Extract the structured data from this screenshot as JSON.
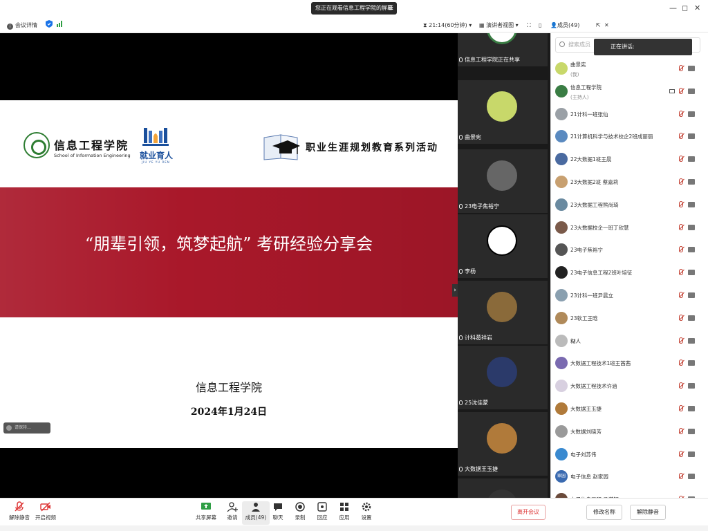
{
  "titlebar": {
    "share_banner": "您正在观看信息工程学院的屏幕",
    "window_controls": [
      "—",
      "◻",
      "✕"
    ]
  },
  "infobar": {
    "meeting_details": "会议详情",
    "timer": "21:14(60分钟)",
    "view_mode": "演讲者视图",
    "participants": "成员(49)"
  },
  "slide": {
    "school_cn": "信息工程学院",
    "school_en": "School of Information Engineering",
    "jy_cn": "就业育人",
    "jy_en": "JIU YE YU REN",
    "career_text": "职业生涯规划教育系列活动",
    "title": "“朋辈引领，筑梦起航” 考研经验分享会",
    "org": "信息工程学院",
    "date": "2024年1月24日",
    "toast": "请保持…"
  },
  "video_tiles": [
    {
      "label": "信息工程学院正在共享",
      "avatar_color": "#3a7d44"
    },
    {
      "label": "曲景宪",
      "avatar_color": "#c8d86a"
    },
    {
      "label": "23电子焦裕宁",
      "avatar_color": "#666666"
    },
    {
      "label": "李杨",
      "avatar_color": "#ffffff"
    },
    {
      "label": "计科葛祥岩",
      "avatar_color": "#8a6a3a"
    },
    {
      "label": "25沈佳蒙",
      "avatar_color": "#2b3a6a"
    },
    {
      "label": "大数据王玉捷",
      "avatar_color": "#b07a3a"
    },
    {
      "label": "",
      "avatar_color": "#333333"
    }
  ],
  "panel": {
    "search_placeholder": "搜索成员",
    "speaking": "正在讲话:",
    "participants": [
      {
        "name": "曲景宪",
        "role": "(我)",
        "color": "#c8d86a"
      },
      {
        "name": "信息工程学院",
        "role": "(主持人)",
        "color": "#3a7d44",
        "share": true
      },
      {
        "name": "21计科一班张仙",
        "role": "",
        "color": "#9aa0a6"
      },
      {
        "name": "21计算机科学与技术校企2班成丽丽",
        "role": "",
        "color": "#5a8ac0"
      },
      {
        "name": "22大数据1班王晨",
        "role": "",
        "color": "#4a6aa0"
      },
      {
        "name": "23大数据2班 蔡嘉莉",
        "role": "",
        "color": "#c8a070"
      },
      {
        "name": "23大数据工程熊尚琦",
        "role": "",
        "color": "#6a8aa0"
      },
      {
        "name": "23大数据校企一班丁欣慧",
        "role": "",
        "color": "#7a5a4a"
      },
      {
        "name": "23电子焦裕宁",
        "role": "",
        "color": "#555555"
      },
      {
        "name": "23电子信息工程2班叶培征",
        "role": "",
        "color": "#222222"
      },
      {
        "name": "23计科一班尹晨立",
        "role": "",
        "color": "#8aa0b0"
      },
      {
        "name": "23软工王晗",
        "role": "",
        "color": "#b08a5a"
      },
      {
        "name": "糊人",
        "role": "",
        "color": "#bbbbbb"
      },
      {
        "name": "大数据工程技术1班王茜茜",
        "role": "",
        "color": "#7a6ab0"
      },
      {
        "name": "大数据工程技术许涵",
        "role": "",
        "color": "#d8d0e0"
      },
      {
        "name": "大数据王玉捷",
        "role": "",
        "color": "#b07a3a"
      },
      {
        "name": "大数据刘晓芳",
        "role": "",
        "color": "#9a9a9a"
      },
      {
        "name": "电子刘苏伟",
        "role": "",
        "color": "#3a8ad0"
      },
      {
        "name": "电子信息 赵家园",
        "role": "",
        "color": "#3a6ab0",
        "avatar_text": "家园"
      },
      {
        "name": "电子信息工程 马滢钰",
        "role": "",
        "color": "#6a4a3a"
      }
    ]
  },
  "toolbar": {
    "unmute": "解除静音",
    "start_video": "开启视频",
    "share_screen": "共享屏幕",
    "invite": "邀请",
    "members": "成员(49)",
    "chat": "聊天",
    "record": "录制",
    "reactions": "回应",
    "apps": "应用",
    "settings": "设置",
    "leave": "离开会议",
    "rename": "修改名称",
    "unmute_all": "解除静音"
  }
}
